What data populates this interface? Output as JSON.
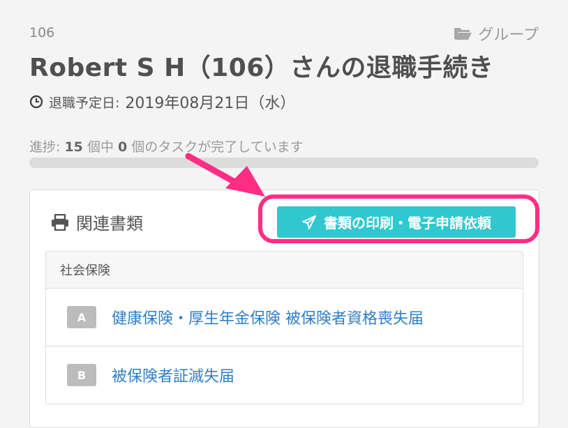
{
  "header": {
    "employee_id": "106",
    "group_label": "グループ",
    "group_icon": "folder-open-icon",
    "title": "Robert S H（106）さんの退職手続き",
    "retirement_label": "退職予定日:",
    "retirement_date": "2019年08月21日（水）"
  },
  "progress": {
    "prefix": "進捗:",
    "total": "15",
    "mid": "個中",
    "done": "0",
    "suffix": "個のタスクが完了しています",
    "fraction": 0
  },
  "documents_card": {
    "title": "関連書類",
    "title_icon": "print-icon",
    "request_button_label": "書類の印刷・電子申請依頼",
    "request_button_icon": "paper-plane-icon",
    "section_label": "社会保険",
    "documents": [
      {
        "badge": "A",
        "name": "健康保険・厚生年金保険 被保険者資格喪失届"
      },
      {
        "badge": "B",
        "name": "被保険者証滅失届"
      }
    ]
  },
  "colors": {
    "accent": "#2fc8d1",
    "highlight": "#ff2d84",
    "link": "#2f7fc8"
  }
}
